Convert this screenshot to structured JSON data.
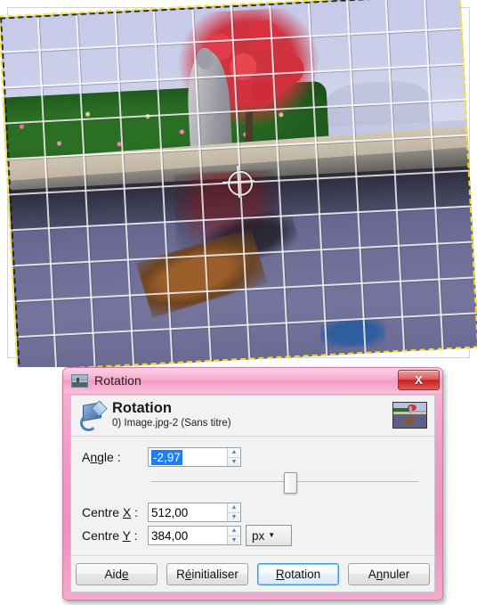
{
  "canvas": {
    "name": "image-canvas",
    "pivot_icon": "crosshair-icon",
    "selection_style": "marching-ants",
    "grid_overlay": true,
    "rotation_preview_deg": -2.97
  },
  "dialog": {
    "titlebar": {
      "icon": "image-thumbnail-icon",
      "title": "Rotation",
      "close_label": "X",
      "close_icon": "close-icon"
    },
    "header": {
      "icon": "rotate-tool-icon",
      "title": "Rotation",
      "subtitle": "0) Image.jpg-2 (Sans titre)",
      "preview_icon": "layer-preview-thumbnail"
    },
    "fields": {
      "angle": {
        "label_pre": "A",
        "label_mn": "n",
        "label_post": "gle :",
        "label_full": "Angle :",
        "value": "-2,97",
        "selected": true,
        "spin_up": "▲",
        "spin_down": "▼"
      },
      "slider": {
        "name": "angle-slider",
        "position_pct": 48.5
      },
      "centre_x": {
        "label_pre": "Centre ",
        "label_mn": "X",
        "label_post": " :",
        "label_full": "Centre X :",
        "value": "512,00"
      },
      "centre_y": {
        "label_pre": "Centre ",
        "label_mn": "Y",
        "label_post": " :",
        "label_full": "Centre Y :",
        "value": "384,00"
      },
      "unit": {
        "value": "px",
        "caret": "▼",
        "caret_icon": "chevron-down-icon"
      }
    },
    "buttons": [
      {
        "pre": "Aid",
        "mn": "e",
        "post": "",
        "full": "Aide",
        "focused": false
      },
      {
        "pre": "R",
        "mn": "é",
        "post": "initialiser",
        "full": "Réinitialiser",
        "focused": false
      },
      {
        "pre": "",
        "mn": "R",
        "post": "otation",
        "full": "Rotation",
        "focused": true
      },
      {
        "pre": "A",
        "mn": "n",
        "post": "nuler",
        "full": "Annuler",
        "focused": false
      }
    ]
  },
  "colors": {
    "dialog_frame": "#ee8fbd",
    "titlebar_light": "#fbd2e6",
    "close_red": "#c32222",
    "selection_highlight": "#1d7ff5",
    "focus_blue": "#3c9bdc",
    "ants_yellow": "#ffe800"
  }
}
